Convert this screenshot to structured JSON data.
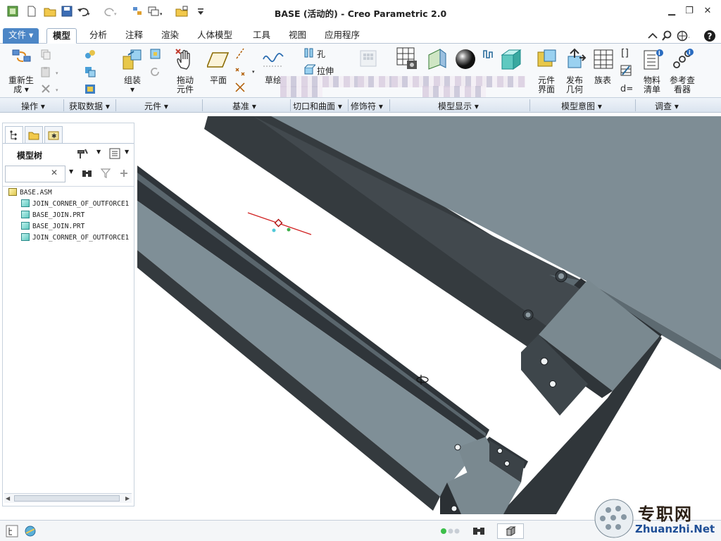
{
  "window": {
    "title": "BASE (活动的) - Creo Parametric 2.0",
    "controls": [
      "minimize",
      "restore",
      "close"
    ]
  },
  "quick_access": [
    "new",
    "open",
    "save",
    "undo",
    "redo",
    "regenerate",
    "windows",
    "close-window",
    "customize"
  ],
  "menu": {
    "tabs": [
      {
        "label": "文件 ▾",
        "active": false
      },
      {
        "label": "模型",
        "active": true
      },
      {
        "label": "分析",
        "active": false
      },
      {
        "label": "注释",
        "active": false
      },
      {
        "label": "渲染",
        "active": false
      },
      {
        "label": "人体模型",
        "active": false
      },
      {
        "label": "工具",
        "active": false
      },
      {
        "label": "视图",
        "active": false
      },
      {
        "label": "应用程序",
        "active": false
      }
    ],
    "right_icons": [
      "minimize-ribbon",
      "search",
      "connect",
      "help"
    ]
  },
  "ribbon": {
    "regen_line1": "重新生",
    "regen_line2": "成 ▾",
    "assemble": "组装",
    "drag_line1": "拖动",
    "drag_line2": "元件",
    "plane": "平面",
    "sketch": "草绘",
    "hole": "孔",
    "extrude": "拉伸",
    "comp_iface_line1": "元件",
    "comp_iface_line2": "界面",
    "publish_line1": "发布",
    "publish_line2": "几何",
    "family_table": "族表",
    "bom_line1": "物料",
    "bom_line2": "清单",
    "ref_line1": "参考查",
    "ref_line2": "看器",
    "groups": [
      "操作 ▾",
      "获取数据 ▾",
      "元件 ▾",
      "基准 ▾",
      "切口和曲面 ▾",
      "修饰符 ▾",
      "模型显示 ▾",
      "模型意图 ▾",
      "调查 ▾"
    ]
  },
  "panel": {
    "tabs": [
      "model-tree",
      "folder-browser",
      "favorites"
    ],
    "title": "模型树",
    "search_clear": "✕",
    "tree": [
      {
        "label": "BASE.ASM",
        "level": 0,
        "type": "assembly"
      },
      {
        "label": "JOIN_CORNER_OF_OUTFORCE1",
        "level": 1,
        "type": "part"
      },
      {
        "label": "BASE_JOIN.PRT",
        "level": 1,
        "type": "part"
      },
      {
        "label": "BASE_JOIN.PRT",
        "level": 1,
        "type": "part"
      },
      {
        "label": "JOIN_CORNER_OF_OUTFORCE1",
        "level": 1,
        "type": "part"
      }
    ]
  },
  "view_toolbar": [
    "refit",
    "zoom-in",
    "zoom-out",
    "repaint",
    "display-style",
    "saved-orientations",
    "view-manager",
    "datum-display",
    "spin-center",
    "annotation-display"
  ],
  "watermark": {
    "cn": "专职网",
    "en": "Zhuanzhi.Net"
  },
  "colors": {
    "accent": "#4c86c6",
    "model_face": "#7f8f97",
    "model_dark": "#3a4146",
    "model_edge": "#1a1d20"
  }
}
